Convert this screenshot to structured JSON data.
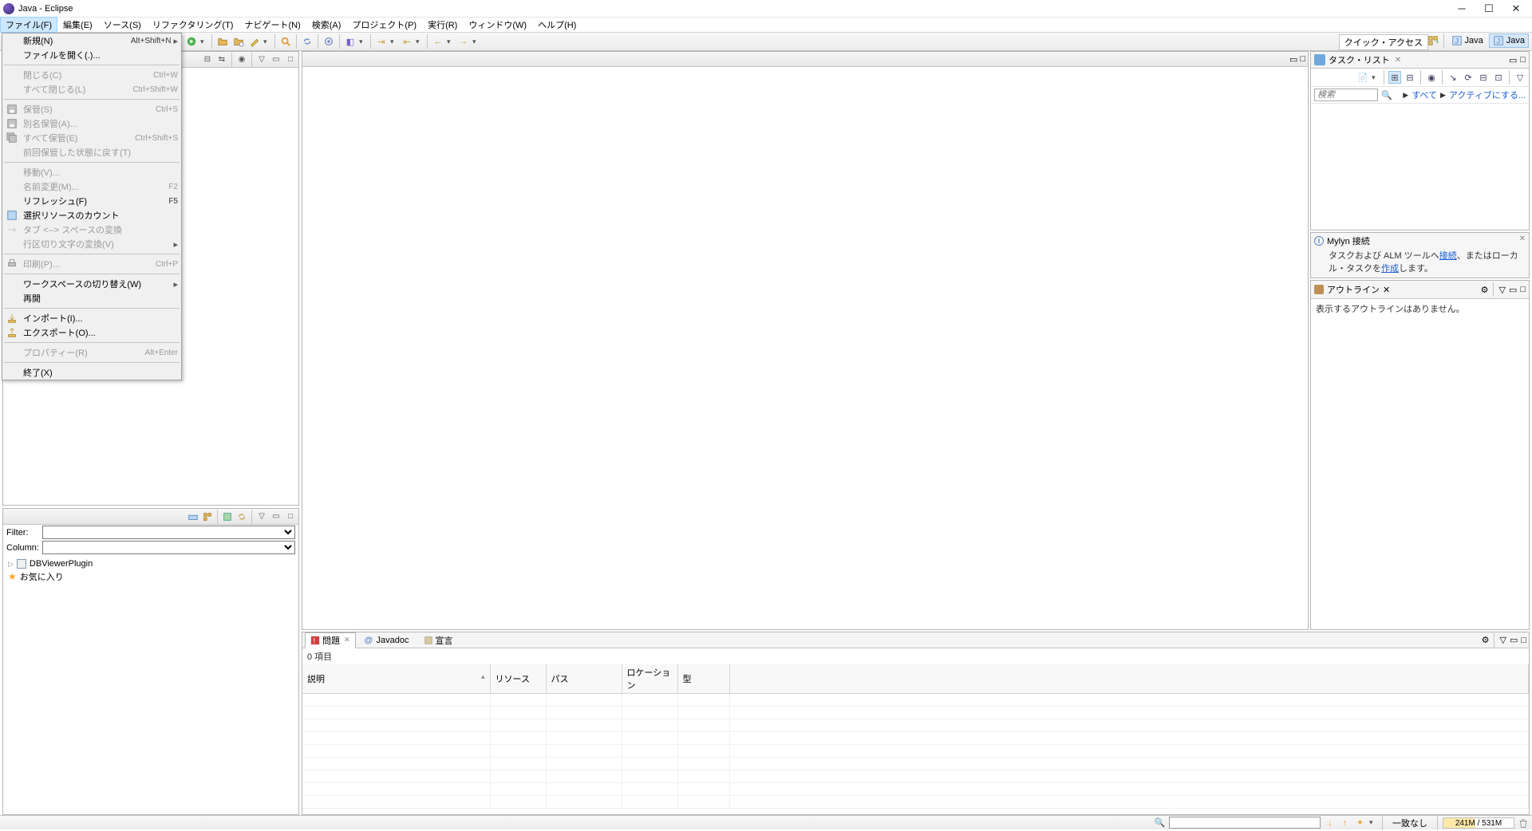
{
  "window": {
    "title": "Java - Eclipse"
  },
  "menubar": [
    "ファイル(F)",
    "編集(E)",
    "ソース(S)",
    "リファクタリング(T)",
    "ナビゲート(N)",
    "検索(A)",
    "プロジェクト(P)",
    "実行(R)",
    "ウィンドウ(W)",
    "ヘルプ(H)"
  ],
  "file_menu": [
    {
      "label": "新規(N)",
      "key": "Alt+Shift+N",
      "sub": true,
      "icon": ""
    },
    {
      "label": "ファイルを開く(.)...",
      "icon": ""
    },
    {
      "sep": true
    },
    {
      "label": "閉じる(C)",
      "key": "Ctrl+W",
      "disabled": true
    },
    {
      "label": "すべて閉じる(L)",
      "key": "Ctrl+Shift+W",
      "disabled": true
    },
    {
      "sep": true
    },
    {
      "label": "保管(S)",
      "key": "Ctrl+S",
      "disabled": true,
      "icon": "save"
    },
    {
      "label": "別名保管(A)...",
      "disabled": true,
      "icon": "save"
    },
    {
      "label": "すべて保管(E)",
      "key": "Ctrl+Shift+S",
      "disabled": true,
      "icon": "saveall"
    },
    {
      "label": "前回保管した状態に戻す(T)",
      "disabled": true
    },
    {
      "sep": true
    },
    {
      "label": "移動(V)...",
      "disabled": true
    },
    {
      "label": "名前変更(M)...",
      "key": "F2",
      "disabled": true
    },
    {
      "label": "リフレッシュ(F)",
      "key": "F5"
    },
    {
      "label": "選択リソースのカウント",
      "icon": "count"
    },
    {
      "label": "タブ <--> スペースの変換",
      "disabled": true,
      "icon": "tab"
    },
    {
      "label": "行区切り文字の変換(V)",
      "sub": true,
      "disabled": true
    },
    {
      "sep": true
    },
    {
      "label": "印刷(P)...",
      "key": "Ctrl+P",
      "disabled": true,
      "icon": "print"
    },
    {
      "sep": true
    },
    {
      "label": "ワークスペースの切り替え(W)",
      "sub": true
    },
    {
      "label": "再開"
    },
    {
      "sep": true
    },
    {
      "label": "インポート(I)...",
      "icon": "import"
    },
    {
      "label": "エクスポート(O)...",
      "icon": "export"
    },
    {
      "sep": true
    },
    {
      "label": "プロパティー(R)",
      "key": "Alt+Enter",
      "disabled": true
    },
    {
      "sep": true
    },
    {
      "label": "終了(X)"
    }
  ],
  "quick_access": "クイック・アクセス",
  "perspectives": [
    {
      "label": "Java"
    },
    {
      "label": "Java",
      "active": true
    }
  ],
  "dbview": {
    "filter_label": "Filter:",
    "column_label": "Column:",
    "nodes": [
      {
        "label": "DBViewerPlugin",
        "icon": "db"
      },
      {
        "label": "お気に入り",
        "icon": "star"
      }
    ]
  },
  "tasklist": {
    "tab": "タスク・リスト",
    "search_placeholder": "検索",
    "all": "すべて",
    "activate": "アクティブにする..."
  },
  "mylyn": {
    "title": "Mylyn 接続",
    "text_pre": "タスクおよび ALM ツールへ",
    "link1": "接続",
    "text_mid": "、またはローカル・タスクを",
    "link2": "作成",
    "text_post": "します。"
  },
  "outline": {
    "tab": "アウトライン",
    "empty": "表示するアウトラインはありません。"
  },
  "problems": {
    "tabs": [
      {
        "label": "問題",
        "active": true,
        "closeable": true,
        "color": "#d04040"
      },
      {
        "label": "Javadoc",
        "icon": "@"
      },
      {
        "label": "宣言",
        "icon": "decl"
      }
    ],
    "count": "0 項目",
    "columns": [
      "説明",
      "リソース",
      "パス",
      "ロケーション",
      "型"
    ]
  },
  "status": {
    "match": "一致なし",
    "heap": "241M / 531M"
  }
}
